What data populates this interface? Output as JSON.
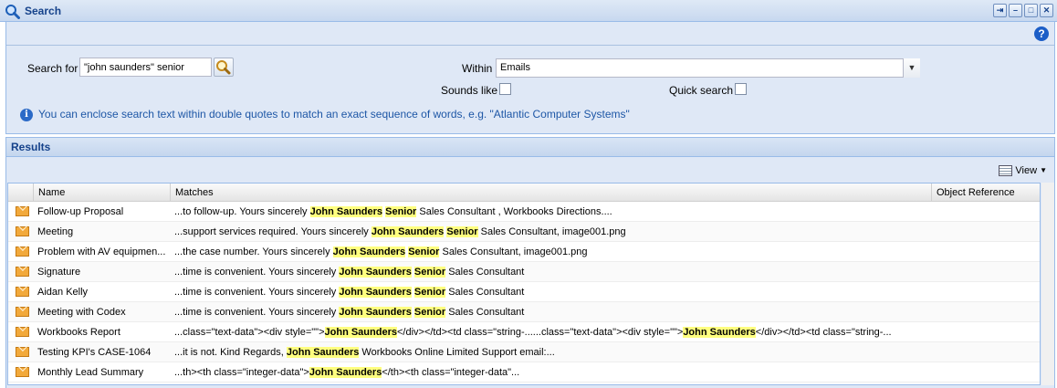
{
  "window": {
    "title": "Search"
  },
  "form": {
    "search_label": "Search for",
    "search_value": "\"john saunders\" senior",
    "within_label": "Within",
    "within_value": "Emails",
    "sounds_like_label": "Sounds like",
    "quick_search_label": "Quick search",
    "info_text": "You can enclose search text within double quotes to match an exact sequence of words, e.g. \"Atlantic Computer Systems\""
  },
  "results": {
    "title": "Results",
    "view_label": "View",
    "columns": [
      "Name",
      "Matches",
      "Object Reference"
    ],
    "rows": [
      {
        "name": "Follow-up Proposal",
        "parts": [
          "...to follow-up. Yours sincerely ",
          "John Saunders",
          " ",
          "Senior",
          " Sales Consultant , Workbooks Directions...."
        ]
      },
      {
        "name": "Meeting",
        "parts": [
          "...support services required. Yours sincerely ",
          "John Saunders",
          " ",
          "Senior",
          " Sales Consultant, image001.png"
        ]
      },
      {
        "name": "Problem with AV equipmen...",
        "parts": [
          "...the case number. Yours sincerely ",
          "John Saunders",
          " ",
          "Senior",
          " Sales Consultant, image001.png"
        ]
      },
      {
        "name": "Signature",
        "parts": [
          "...time is convenient. Yours sincerely ",
          "John Saunders",
          " ",
          "Senior",
          " Sales Consultant"
        ]
      },
      {
        "name": "Aidan Kelly",
        "parts": [
          "...time is convenient. Yours sincerely ",
          "John Saunders",
          " ",
          "Senior",
          " Sales Consultant"
        ]
      },
      {
        "name": "Meeting with Codex",
        "parts": [
          "...time is convenient. Yours sincerely ",
          "John Saunders",
          " ",
          "Senior",
          " Sales Consultant"
        ]
      },
      {
        "name": "Workbooks Report",
        "parts": [
          "...class=\"text-data\"><div style=\"\">",
          "John Saunders",
          "</div></td><td class=\"string-......class=\"text-data\"><div style=\"\">",
          "John Saunders",
          "</div></td><td class=\"string-..."
        ]
      },
      {
        "name": "Testing KPI's CASE-1064",
        "parts": [
          "...it is not. Kind Regards, ",
          "John Saunders",
          " Workbooks Online Limited Support email:...",
          "",
          ""
        ]
      },
      {
        "name": "Monthly Lead Summary",
        "parts": [
          "...th><th class=\"integer-data\">",
          "John Saunders",
          "</th><th class=\"integer-data\"...",
          "",
          ""
        ]
      }
    ]
  },
  "colors": {
    "accent": "#15428b",
    "highlight": "#ffff7f",
    "panel": "#dfe8f6"
  }
}
